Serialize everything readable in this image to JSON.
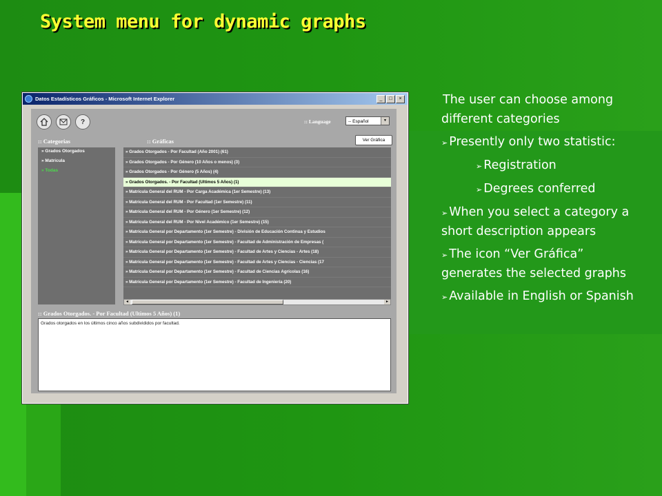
{
  "slide": {
    "title": "System menu for dynamic graphs",
    "bullets": [
      {
        "text": "The user can choose among different categories",
        "marker": ""
      },
      {
        "text": "Presently only two statistic:",
        "marker": "➢"
      },
      {
        "text": "Registration",
        "marker": "➢",
        "sub": true
      },
      {
        "text": "Degrees conferred",
        "marker": "➢",
        "sub": true
      },
      {
        "text": "When you select a category a short description appears",
        "marker": "➢"
      },
      {
        "text": "The icon “Ver Gráfica” generates the selected graphs",
        "marker": "➢"
      },
      {
        "text": "Available in English or Spanish",
        "marker": "➢"
      }
    ]
  },
  "window": {
    "title": "Datos Estadísticos Gráficos - Microsoft Internet Explorer",
    "buttons": [
      "_",
      "□",
      "×"
    ]
  },
  "toolbar": {
    "home_icon": "home-icon",
    "mail_icon": "mail-icon",
    "help_icon": "?",
    "language_label": ":: Language",
    "language_value": "-- Español",
    "ver_grafica_label": "Ver Gráfica"
  },
  "categorias": {
    "header": ":: Categorias",
    "items": [
      {
        "label": "» Grados Otorgados",
        "active": false
      },
      {
        "label": "» Matrícula",
        "active": false
      },
      {
        "label": "» Todas",
        "active": true
      }
    ]
  },
  "graficas": {
    "header": ":: Gráficas",
    "items": [
      {
        "label": "» Grados Otorgados - Por Facultad (Año 2001) (61)",
        "selected": false
      },
      {
        "label": "» Grados Otorgados - Por Género (10 Años o menos) (3)",
        "selected": false
      },
      {
        "label": "» Grados Otorgados - Por Género (5 Años) (4)",
        "selected": false
      },
      {
        "label": "» Grados Otorgados. - Por Facultad (Ultimos 5 Años) (1)",
        "selected": true
      },
      {
        "label": "» Matrícula General del RUM - Por Carga Académica (1er Semestre) (13)",
        "selected": false
      },
      {
        "label": "» Matrícula General del RUM - Por Facultad (1er Semestre) (11)",
        "selected": false
      },
      {
        "label": "» Matrícula General del RUM - Por Género (1er Semestre) (12)",
        "selected": false
      },
      {
        "label": "» Matrícula General del RUM - Por Nivel Académico (1er Semestre) (15)",
        "selected": false
      },
      {
        "label": "» Matrícula General por Departamento (1er Semestre) - División de Educación Continua y Estudios",
        "selected": false
      },
      {
        "label": "» Matrícula General por Departamento (1er Semestre) - Facultad de Administración de Empresas (",
        "selected": false
      },
      {
        "label": "» Matrícula General por Departamento (1er Semestre) - Facultad de Artes y Ciencias - Artes (18)",
        "selected": false
      },
      {
        "label": "» Matrícula General por Departamento (1er Semestre) - Facultad de Artes y Ciencias - Ciencias (17",
        "selected": false
      },
      {
        "label": "» Matrícula General por Departamento (1er Semestre) - Facultad de Ciencias Agrícolas (16)",
        "selected": false
      },
      {
        "label": "» Matrícula General por Departamento (1er Semestre) - Facultad de Ingeniería (20)",
        "selected": false
      }
    ]
  },
  "description": {
    "header": ":: Grados Otorgados. - Por Facultad (Ultimos 5 Años) (1)",
    "text": "Grados otorgados en los últimos cinco años subdivididos por facultad."
  }
}
